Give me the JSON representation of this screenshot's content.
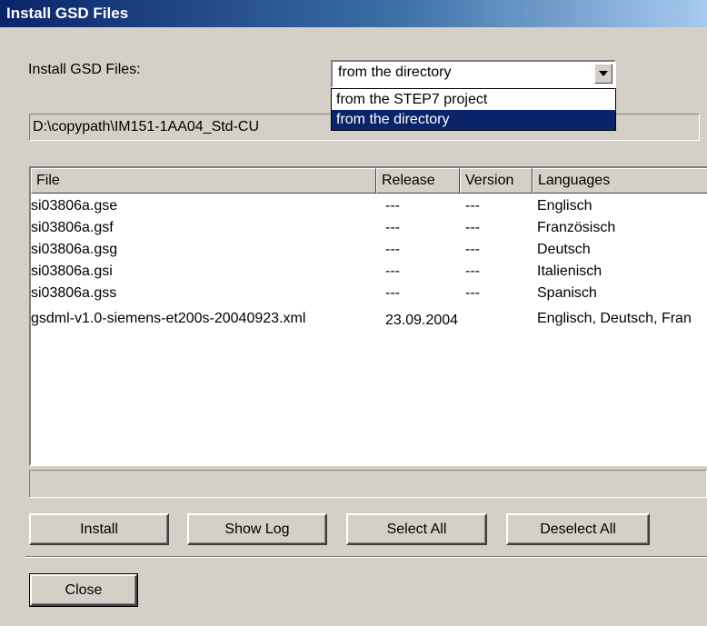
{
  "window": {
    "title": "Install GSD Files"
  },
  "source": {
    "label": "Install GSD Files:",
    "selected": "from the directory",
    "options": [
      "from the STEP7 project",
      "from the directory"
    ]
  },
  "path": {
    "value": "D:\\copypath\\IM151-1AA04_Std-CU"
  },
  "table": {
    "columns": [
      "File",
      "Release",
      "Version",
      "Languages"
    ],
    "rows": [
      {
        "file": "si03806a.gse",
        "release": "---",
        "version": "---",
        "languages": "Englisch"
      },
      {
        "file": "si03806a.gsf",
        "release": "---",
        "version": "---",
        "languages": "Französisch"
      },
      {
        "file": "si03806a.gsg",
        "release": "---",
        "version": "---",
        "languages": "Deutsch"
      },
      {
        "file": "si03806a.gsi",
        "release": "---",
        "version": "---",
        "languages": "Italienisch"
      },
      {
        "file": "si03806a.gss",
        "release": "---",
        "version": "---",
        "languages": "Spanisch"
      },
      {
        "file": "gsdml-v1.0-siemens-et200s-20040923.xml",
        "release": "23.09.2004",
        "version": "",
        "languages": "Englisch, Deutsch, Fran"
      }
    ]
  },
  "status": {
    "text": ""
  },
  "buttons": {
    "install": "Install",
    "show_log": "Show Log",
    "select_all": "Select All",
    "deselect_all": "Deselect All",
    "close": "Close"
  }
}
